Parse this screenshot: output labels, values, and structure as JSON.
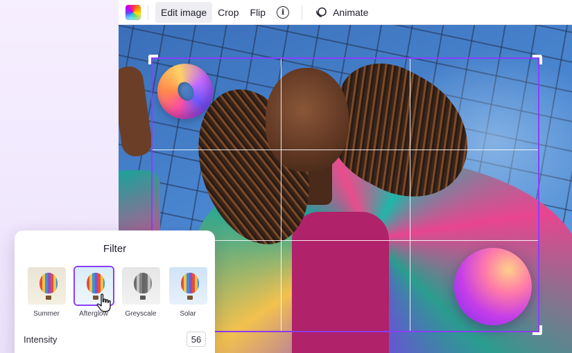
{
  "toolbar": {
    "color_swatch_icon": "gradient-color-swatch-icon",
    "edit_image_label": "Edit image",
    "crop_label": "Crop",
    "flip_label": "Flip",
    "info_icon": "info-icon",
    "animate_icon": "animate-layers-icon",
    "animate_label": "Animate"
  },
  "filter_panel": {
    "title": "Filter",
    "filters": [
      {
        "label": "Summer",
        "selected": false
      },
      {
        "label": "Afterglow",
        "selected": true
      },
      {
        "label": "Greyscale",
        "selected": false
      },
      {
        "label": "Solar",
        "selected": false
      }
    ],
    "intensity_label": "Intensity",
    "intensity_value": "56"
  },
  "colors": {
    "accent": "#8b3dff",
    "panel_bg": "#ffffff",
    "page_bg": "#f3ecfd"
  }
}
